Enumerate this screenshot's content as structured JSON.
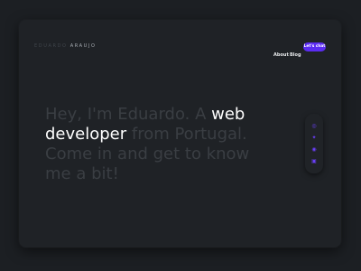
{
  "logo": {
    "first": "EDUARDO",
    "last": "ARAUJO"
  },
  "nav": {
    "about": "About",
    "blog": "Blog",
    "cta": "Let's chat"
  },
  "hero": {
    "part1": "Hey, I'm Eduardo. A ",
    "highlight1": "web",
    "highlight2": "developer",
    "part2": " from Portugal. Come in and get to know me a bit!"
  },
  "social": [
    {
      "icon": "dribbble-icon",
      "glyph": "◎"
    },
    {
      "icon": "twitter-icon",
      "glyph": "✦"
    },
    {
      "icon": "github-icon",
      "glyph": "◉"
    },
    {
      "icon": "linkedin-icon",
      "glyph": "▣"
    }
  ],
  "colors": {
    "accent": "#5b2cf2",
    "background": "#1f2226",
    "muted_text": "#3a3e43",
    "highlight_text": "#ffffff"
  }
}
